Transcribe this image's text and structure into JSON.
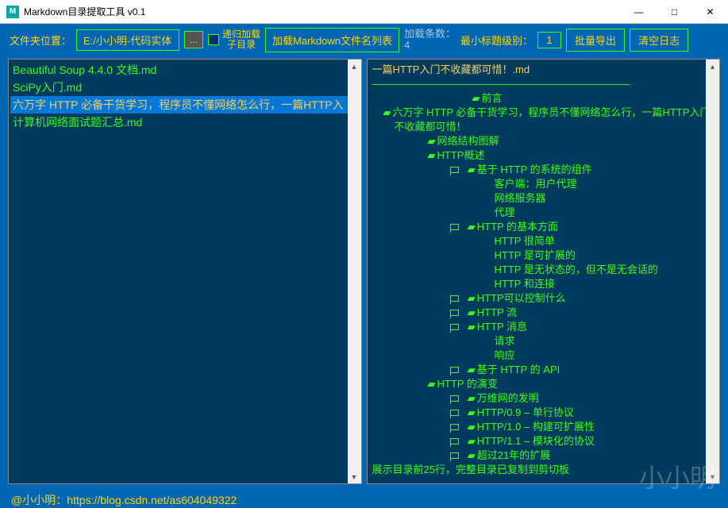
{
  "window": {
    "title": "Markdown目录提取工具 v0.1",
    "min": "—",
    "max": "□",
    "close": "✕"
  },
  "toolbar": {
    "folder_label": "文件夹位置：",
    "folder_path": "E:/小小明-代码实体",
    "browse": "...",
    "recurse_label1": "递归加载",
    "recurse_label2": "子目录",
    "load_btn": "加载Markdown文件名列表",
    "load_count_label": "加载条数：",
    "load_count_value": "4",
    "min_level_label": "最小标题级别：",
    "min_level_value": "1",
    "export_btn": "批量导出",
    "clear_btn": "清空日志"
  },
  "files": [
    "Beautiful Soup 4.4.0 文档.md",
    "SciPy入门.md",
    "六万字 HTTP 必备干货学习，程序员不懂网络怎么行，一篇HTTP入",
    "计算机网络面试题汇总.md"
  ],
  "selected_file_index": 2,
  "tree": {
    "title": "一篇HTTP入门不收藏都可惜！.md",
    "divider": "—————————————————————————",
    "lines": [
      {
        "indent": 9,
        "flag": false,
        "book": true,
        "text": "前言"
      },
      {
        "indent": 1,
        "flag": false,
        "book": true,
        "text": "六万字 HTTP 必备干货学习，程序员不懂网络怎么行，一篇HTTP入门不收藏都可惜！",
        "wrap": true
      },
      {
        "indent": 5,
        "flag": false,
        "book": true,
        "text": "网络结构图解"
      },
      {
        "indent": 5,
        "flag": false,
        "book": true,
        "text": "HTTP概述"
      },
      {
        "indent": 7,
        "flag": true,
        "book": true,
        "text": "基于 HTTP 的系统的组件"
      },
      {
        "indent": 11,
        "flag": false,
        "book": false,
        "text": "客户端：用户代理"
      },
      {
        "indent": 11,
        "flag": false,
        "book": false,
        "text": "网络服务器"
      },
      {
        "indent": 11,
        "flag": false,
        "book": false,
        "text": "代理"
      },
      {
        "indent": 7,
        "flag": true,
        "book": true,
        "text": "HTTP 的基本方面"
      },
      {
        "indent": 11,
        "flag": false,
        "book": false,
        "text": "HTTP 很简单"
      },
      {
        "indent": 11,
        "flag": false,
        "book": false,
        "text": "HTTP 是可扩展的"
      },
      {
        "indent": 11,
        "flag": false,
        "book": false,
        "text": "HTTP 是无状态的，但不是无会话的"
      },
      {
        "indent": 11,
        "flag": false,
        "book": false,
        "text": "HTTP 和连接"
      },
      {
        "indent": 7,
        "flag": true,
        "book": true,
        "text": "HTTP可以控制什么"
      },
      {
        "indent": 7,
        "flag": true,
        "book": true,
        "text": "HTTP 流"
      },
      {
        "indent": 7,
        "flag": true,
        "book": true,
        "text": "HTTP 消息"
      },
      {
        "indent": 11,
        "flag": false,
        "book": false,
        "text": "请求"
      },
      {
        "indent": 11,
        "flag": false,
        "book": false,
        "text": "响应"
      },
      {
        "indent": 7,
        "flag": true,
        "book": true,
        "text": "基于 HTTP 的 API"
      },
      {
        "indent": 5,
        "flag": false,
        "book": true,
        "text": "HTTP 的演变"
      },
      {
        "indent": 7,
        "flag": true,
        "book": true,
        "text": "万维网的发明"
      },
      {
        "indent": 7,
        "flag": true,
        "book": true,
        "text": "HTTP/0.9 – 单行协议"
      },
      {
        "indent": 7,
        "flag": true,
        "book": true,
        "text": "HTTP/1.0 – 构建可扩展性"
      },
      {
        "indent": 7,
        "flag": true,
        "book": true,
        "text": "HTTP/1.1 – 模块化的协议"
      },
      {
        "indent": 7,
        "flag": true,
        "book": true,
        "text": "超过21年的扩展"
      }
    ],
    "footer_line": "展示目录前25行，完整目录已复制到剪切板"
  },
  "footer": {
    "prefix": "@小小明：",
    "url": "https://blog.csdn.net/as604049322"
  },
  "watermark": "小小明"
}
